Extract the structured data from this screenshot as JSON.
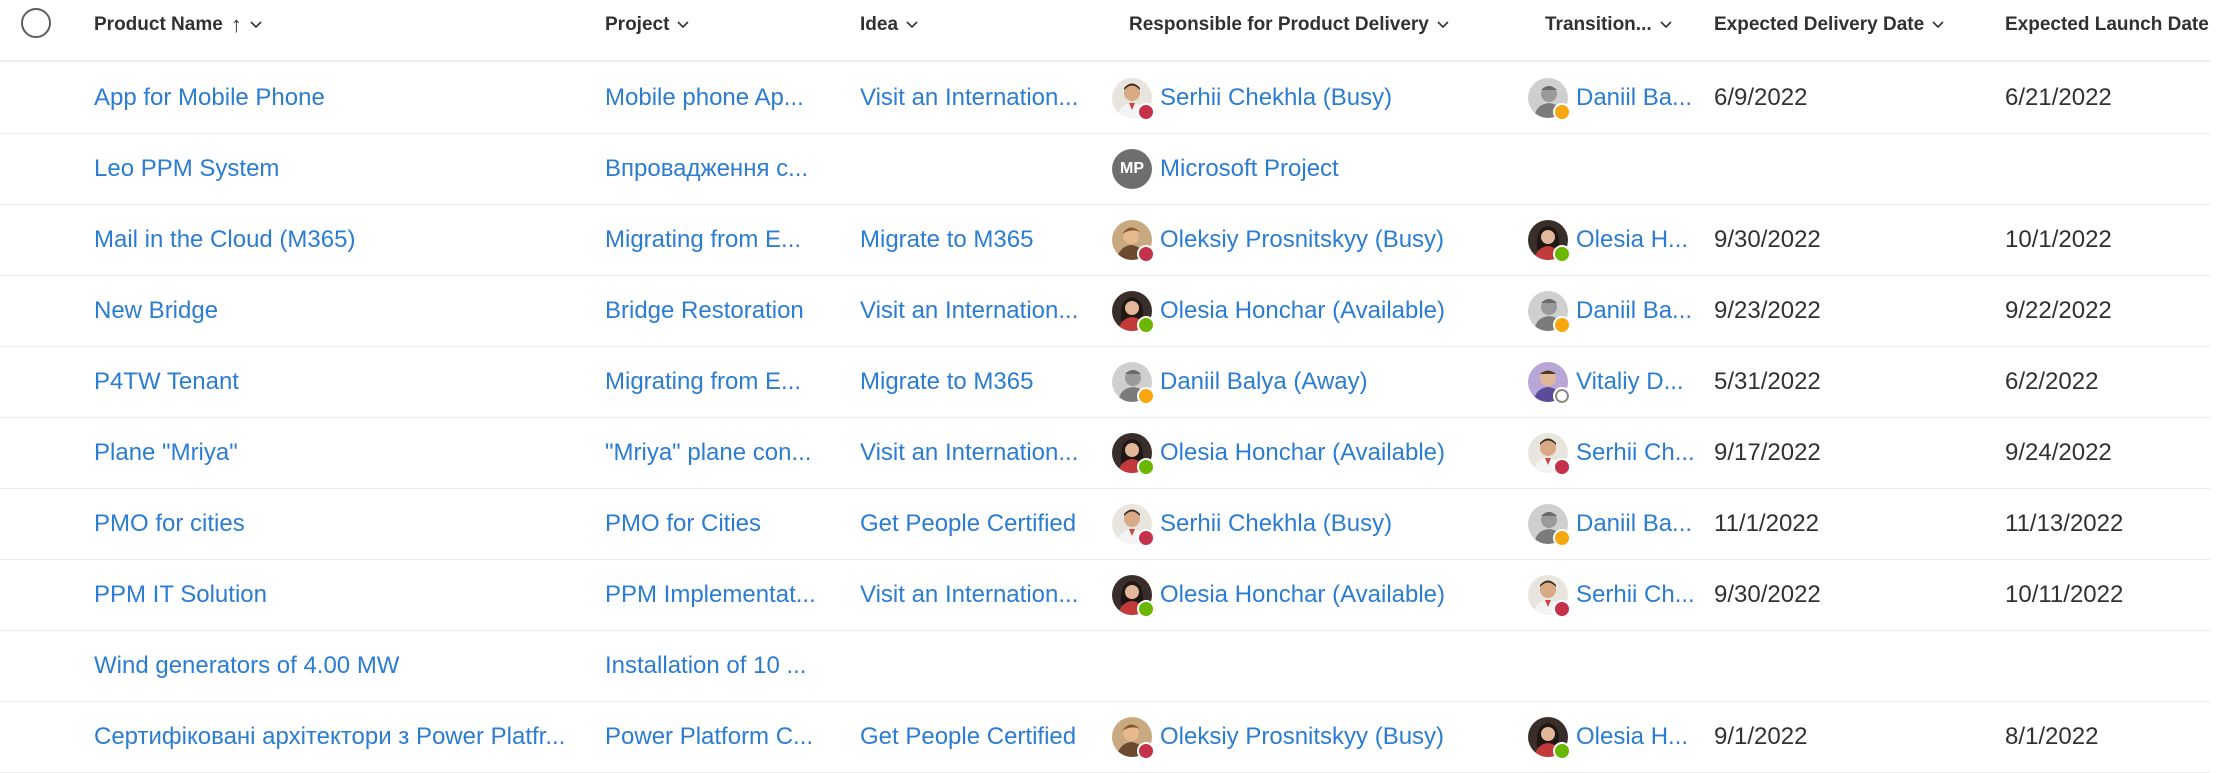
{
  "header": {
    "product_name": "Product Name",
    "project": "Project",
    "idea": "Idea",
    "responsible": "Responsible for Product Delivery",
    "transition": "Transition...",
    "expected_delivery": "Expected Delivery Date",
    "expected_launch": "Expected Launch Date",
    "sort_arrow": "↑"
  },
  "rows": [
    {
      "product": "App for Mobile Phone",
      "project": "Mobile phone Ap...",
      "idea": "Visit an Internation...",
      "responsible": {
        "name": "Serhii Chekhla (Busy)",
        "status": "busy",
        "avatar": "serhii",
        "initials": ""
      },
      "transition": {
        "name": "Daniil Ba...",
        "status": "away",
        "avatar": "daniil",
        "initials": ""
      },
      "delivery": "6/9/2022",
      "launch": "6/21/2022"
    },
    {
      "product": "Leo PPM System",
      "project": "Впровадження с...",
      "idea": "",
      "responsible": {
        "name": "Microsoft Project",
        "status": "",
        "avatar": "initials",
        "initials": "MP"
      },
      "transition": null,
      "delivery": "",
      "launch": ""
    },
    {
      "product": "Mail in the Cloud (M365)",
      "project": "Migrating from E...",
      "idea": "Migrate to M365",
      "responsible": {
        "name": "Oleksiy Prosnitskyy (Busy)",
        "status": "busy",
        "avatar": "oleksiy",
        "initials": ""
      },
      "transition": {
        "name": "Olesia H...",
        "status": "available",
        "avatar": "olesia",
        "initials": ""
      },
      "delivery": "9/30/2022",
      "launch": "10/1/2022"
    },
    {
      "product": "New Bridge",
      "project": "Bridge Restoration",
      "idea": "Visit an Internation...",
      "responsible": {
        "name": "Olesia Honchar (Available)",
        "status": "available",
        "avatar": "olesia",
        "initials": ""
      },
      "transition": {
        "name": "Daniil Ba...",
        "status": "away",
        "avatar": "daniil",
        "initials": ""
      },
      "delivery": "9/23/2022",
      "launch": "9/22/2022"
    },
    {
      "product": "P4TW Tenant",
      "project": "Migrating from E...",
      "idea": "Migrate to M365",
      "responsible": {
        "name": "Daniil Balya (Away)",
        "status": "away",
        "avatar": "daniil",
        "initials": ""
      },
      "transition": {
        "name": "Vitaliy D...",
        "status": "offline",
        "avatar": "vitaliy",
        "initials": ""
      },
      "delivery": "5/31/2022",
      "launch": "6/2/2022"
    },
    {
      "product": "Plane \"Mriya\"",
      "project": "\"Mriya\" plane con...",
      "idea": "Visit an Internation...",
      "responsible": {
        "name": "Olesia Honchar (Available)",
        "status": "available",
        "avatar": "olesia",
        "initials": ""
      },
      "transition": {
        "name": "Serhii Ch...",
        "status": "busy",
        "avatar": "serhii",
        "initials": ""
      },
      "delivery": "9/17/2022",
      "launch": "9/24/2022"
    },
    {
      "product": "PMO for cities",
      "project": "PMO for Cities",
      "idea": "Get People Certified",
      "responsible": {
        "name": "Serhii Chekhla (Busy)",
        "status": "busy",
        "avatar": "serhii",
        "initials": ""
      },
      "transition": {
        "name": "Daniil Ba...",
        "status": "away",
        "avatar": "daniil",
        "initials": ""
      },
      "delivery": "11/1/2022",
      "launch": "11/13/2022"
    },
    {
      "product": "PPM IT Solution",
      "project": "PPM Implementat...",
      "idea": "Visit an Internation...",
      "responsible": {
        "name": "Olesia Honchar (Available)",
        "status": "available",
        "avatar": "olesia",
        "initials": ""
      },
      "transition": {
        "name": "Serhii Ch...",
        "status": "busy",
        "avatar": "serhii",
        "initials": ""
      },
      "delivery": "9/30/2022",
      "launch": "10/11/2022"
    },
    {
      "product": "Wind generators of 4.00 MW",
      "project": "Installation of 10 ...",
      "idea": "",
      "responsible": null,
      "transition": null,
      "delivery": "",
      "launch": ""
    },
    {
      "product": "Сертифіковані архітектори з Power Platfr...",
      "project": "Power Platform C...",
      "idea": "Get People Certified",
      "responsible": {
        "name": "Oleksiy Prosnitskyy (Busy)",
        "status": "busy",
        "avatar": "oleksiy",
        "initials": ""
      },
      "transition": {
        "name": "Olesia H...",
        "status": "available",
        "avatar": "olesia",
        "initials": ""
      },
      "delivery": "9/1/2022",
      "launch": "8/1/2022"
    }
  ],
  "colors": {
    "link": "#2b7cd3",
    "text": "#323130",
    "busy": "#c4314b",
    "available": "#6bb700",
    "away": "#f8a70e"
  }
}
